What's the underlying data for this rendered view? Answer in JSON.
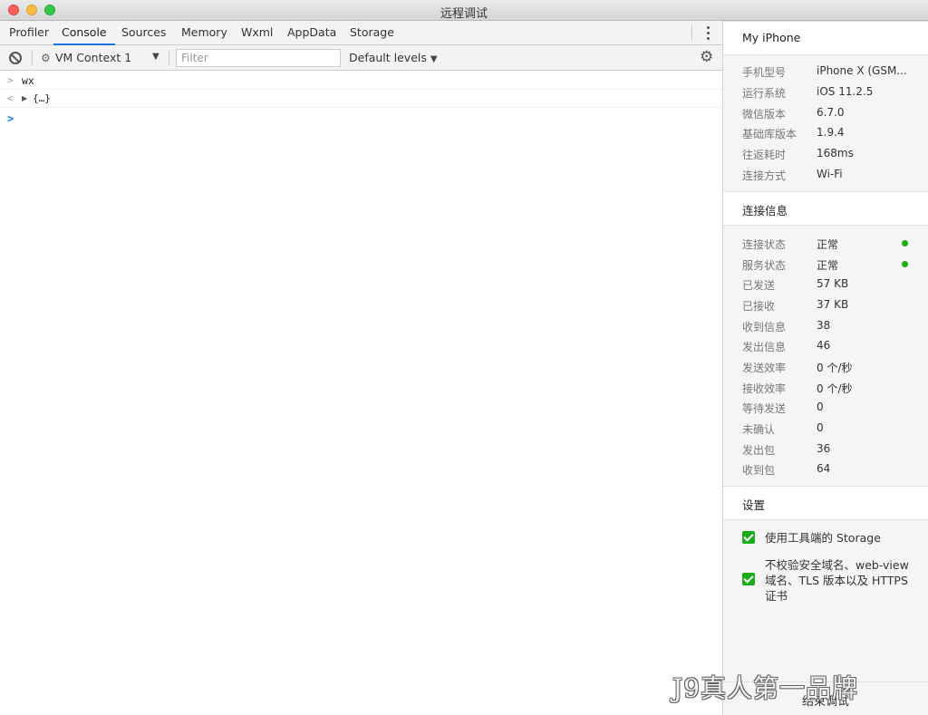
{
  "window": {
    "title": "远程调试"
  },
  "tabs": [
    {
      "label": "Profiler"
    },
    {
      "label": "Console"
    },
    {
      "label": "Sources"
    },
    {
      "label": "Memory"
    },
    {
      "label": "Wxml"
    },
    {
      "label": "AppData"
    },
    {
      "label": "Storage"
    }
  ],
  "toolbar": {
    "context_label": "VM Context 1",
    "filter_placeholder": "Filter",
    "filter_value": "",
    "levels_label": "Default levels"
  },
  "console": {
    "input_glyph": ">",
    "output_glyph": "<",
    "lines": [
      {
        "text": "wx"
      },
      {
        "text": "{…}"
      }
    ]
  },
  "device": {
    "title": "My iPhone",
    "rows": [
      {
        "label": "手机型号",
        "value": "iPhone X (GSM..."
      },
      {
        "label": "运行系统",
        "value": "iOS 11.2.5"
      },
      {
        "label": "微信版本",
        "value": "6.7.0"
      },
      {
        "label": "基础库版本",
        "value": "1.9.4"
      },
      {
        "label": "往返耗时",
        "value": "168ms"
      },
      {
        "label": "连接方式",
        "value": "Wi-Fi"
      }
    ]
  },
  "connection": {
    "title": "连接信息",
    "status_color": "#1aad19",
    "rows": [
      {
        "label": "连接状态",
        "value": "正常"
      },
      {
        "label": "服务状态",
        "value": "正常"
      },
      {
        "label": "已发送",
        "value": "57 KB"
      },
      {
        "label": "已接收",
        "value": "37 KB"
      },
      {
        "label": "收到信息",
        "value": "38"
      },
      {
        "label": "发出信息",
        "value": "46"
      },
      {
        "label": "发送效率",
        "value": "0 个/秒"
      },
      {
        "label": "接收效率",
        "value": "0 个/秒"
      },
      {
        "label": "等待发送",
        "value": "0"
      },
      {
        "label": "未确认",
        "value": "0"
      },
      {
        "label": "发出包",
        "value": "36"
      },
      {
        "label": "收到包",
        "value": "64"
      }
    ]
  },
  "settings": {
    "title": "设置",
    "options": [
      {
        "label": "使用工具端的 Storage",
        "checked": true
      },
      {
        "label": "不校验安全域名、web-view 域名、TLS 版本以及 HTTPS 证书",
        "checked": true
      }
    ]
  },
  "end_button": {
    "label": "结束调试"
  },
  "watermark": {
    "text": "J9真人第一品牌"
  }
}
